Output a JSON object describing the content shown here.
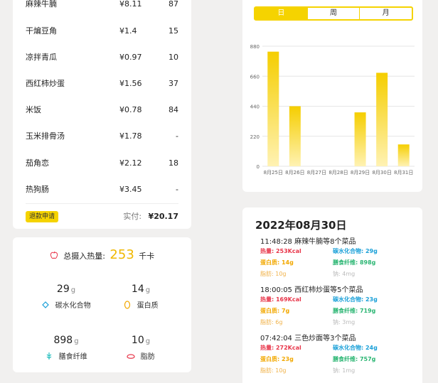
{
  "receipt": {
    "items": [
      {
        "name": "麻辣牛腩",
        "price": "¥8.11",
        "qty": "87"
      },
      {
        "name": "干煸豆角",
        "price": "¥1.4",
        "qty": "15"
      },
      {
        "name": "凉拌青瓜",
        "price": "¥0.97",
        "qty": "10"
      },
      {
        "name": "西红柿炒蛋",
        "price": "¥1.56",
        "qty": "37"
      },
      {
        "name": "米饭",
        "price": "¥0.78",
        "qty": "84"
      },
      {
        "name": "玉米排骨汤",
        "price": "¥1.78",
        "qty": "-"
      },
      {
        "name": "茄角恋",
        "price": "¥2.12",
        "qty": "18"
      },
      {
        "name": "热狗肠",
        "price": "¥3.45",
        "qty": "-"
      }
    ],
    "refund_label": "退款申请",
    "paid_label": "实付:",
    "paid_amount": "¥20.17"
  },
  "nutrition": {
    "total_label": "总摄入热量:",
    "total_value": "253",
    "total_unit": "千卡",
    "carbs": {
      "value": "29",
      "unit": "g",
      "label": "碳水化合物",
      "icon": "carb-icon"
    },
    "protein": {
      "value": "14",
      "unit": "g",
      "label": "蛋白质",
      "icon": "protein-icon"
    },
    "fiber": {
      "value": "898",
      "unit": "g",
      "label": "膳食纤维",
      "icon": "fiber-icon"
    },
    "fat": {
      "value": "10",
      "unit": "g",
      "label": "脂肪",
      "icon": "fat-icon"
    }
  },
  "tabs": {
    "day": "日",
    "week": "周",
    "month": "月",
    "active": "day"
  },
  "chart_data": {
    "type": "bar",
    "categories": [
      "8月25日",
      "8月26日",
      "8月27日",
      "8月28日",
      "8月29日",
      "8月30日",
      "8月31日"
    ],
    "values": [
      840,
      440,
      0,
      0,
      395,
      685,
      160
    ],
    "yticks": [
      "0",
      "220",
      "440",
      "660",
      "880"
    ],
    "ylim": [
      0,
      880
    ],
    "grid": true,
    "colors": {
      "top": "#f5ce00",
      "bottom": "#fff2b3"
    }
  },
  "meals": {
    "date": "2022年08月30日",
    "entries": [
      {
        "header": "11:48:28  麻辣牛腩等8个菜品",
        "heat": "热量: 253Kcal",
        "carbs": "碳水化合物: 29g",
        "protein": "蛋白质: 14g",
        "fiber": "膳食纤维: 898g",
        "fat": "脂肪: 10g",
        "sodium": "钠: 4mg"
      },
      {
        "header": "18:00:05  西红柿炒蛋等5个菜品",
        "heat": "热量: 169Kcal",
        "carbs": "碳水化合物: 23g",
        "protein": "蛋白质: 7g",
        "fiber": "膳食纤维: 719g",
        "fat": "脂肪: 6g",
        "sodium": "钠: 3mg"
      },
      {
        "header": "07:42:04  三色炒面等3个菜品",
        "heat": "热量: 272Kcal",
        "carbs": "碳水化合物: 24g",
        "protein": "蛋白质: 23g",
        "fiber": "膳食纤维: 757g",
        "fat": "脂肪: 10g",
        "sodium": "钠: 1mg"
      }
    ],
    "colors": {
      "heat": "#e8364a",
      "carbs": "#1aa0d8",
      "protein": "#f2a800",
      "fiber": "#2bb673",
      "fat": "#f0b24a",
      "sodium": "#bbbbbb"
    }
  }
}
